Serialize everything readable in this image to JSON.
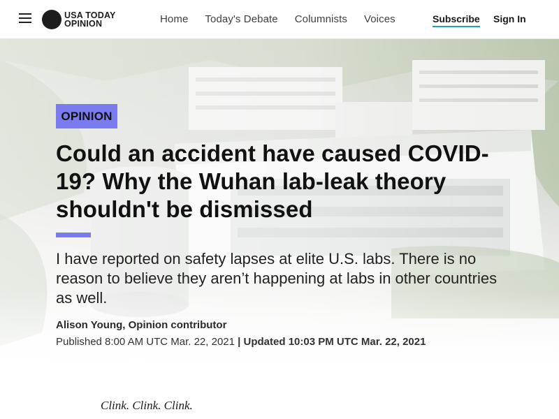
{
  "header": {
    "logo_line1": "USA TODAY",
    "logo_line2": "OPINION",
    "nav": [
      "Home",
      "Today's Debate",
      "Columnists",
      "Voices"
    ],
    "subscribe": "Subscribe",
    "signin": "Sign In"
  },
  "article": {
    "badge": "OPINION",
    "headline": "Could an accident have caused COVID-19? Why the Wuhan lab-leak theory shouldn't be dismissed",
    "dek": "I have reported on safety lapses at elite U.S. labs. There is no reason to believe they aren’t happening at labs in other countries as well.",
    "byline": "Alison Young, Opinion contributor",
    "published": "Published 8:00 AM UTC Mar. 22, 2021",
    "updated": "| Updated 10:03 PM UTC Mar. 22, 2021",
    "first_line": "Clink. Clink. Clink."
  },
  "colors": {
    "accent": "#7b7bf0",
    "subscribe_underline": "#18a3b5"
  }
}
